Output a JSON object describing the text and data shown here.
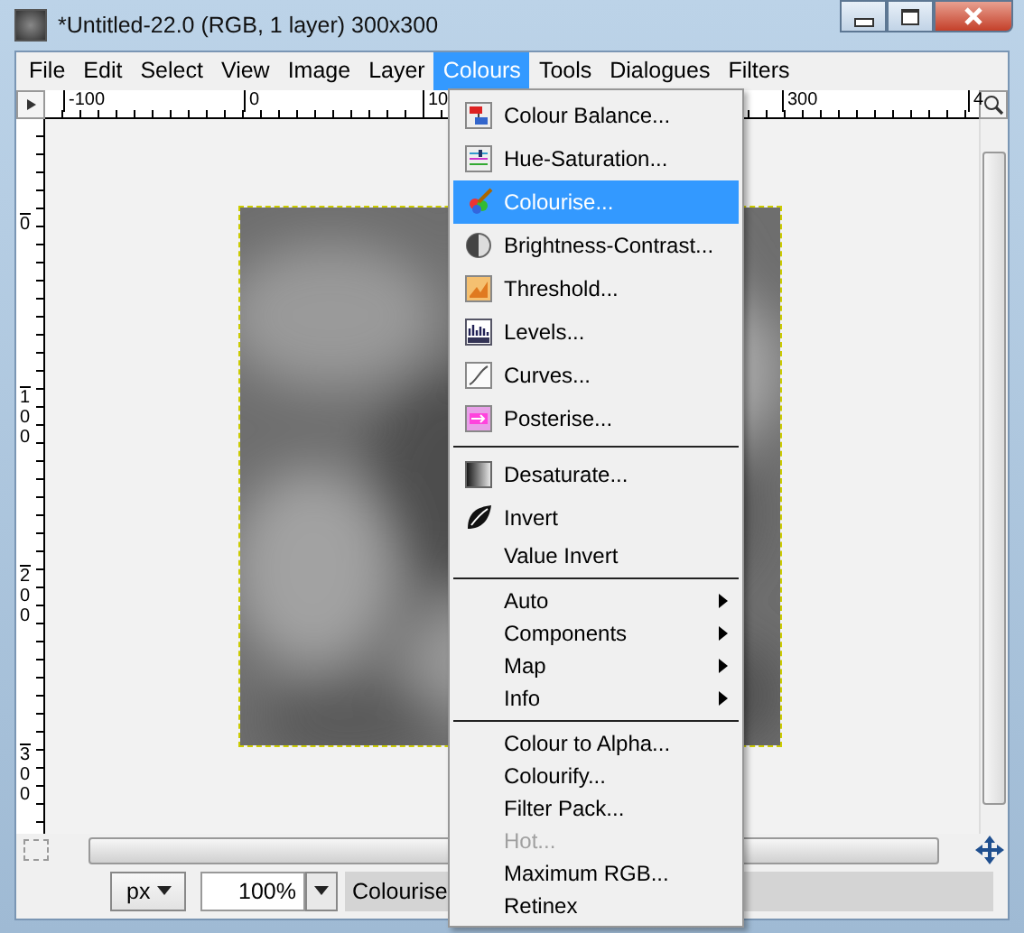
{
  "window": {
    "title": "*Untitled-22.0 (RGB, 1 layer) 300x300"
  },
  "menubar": [
    {
      "label": "File",
      "selected": false
    },
    {
      "label": "Edit",
      "selected": false
    },
    {
      "label": "Select",
      "selected": false
    },
    {
      "label": "View",
      "selected": false
    },
    {
      "label": "Image",
      "selected": false
    },
    {
      "label": "Layer",
      "selected": false
    },
    {
      "label": "Colours",
      "selected": true
    },
    {
      "label": "Tools",
      "selected": false
    },
    {
      "label": "Dialogues",
      "selected": false
    },
    {
      "label": "Filters",
      "selected": false
    }
  ],
  "top_ruler": {
    "labels": [
      "-100",
      "0",
      "10",
      "300",
      "4"
    ]
  },
  "left_ruler": {
    "labels": [
      "0",
      "100",
      "200",
      "300"
    ]
  },
  "status_bar": {
    "unit": "px",
    "zoom": "100%",
    "message": "Colourise"
  },
  "colours_menu": [
    {
      "kind": "icon-item",
      "label": "Colour Balance...",
      "selected": false,
      "disabled": false
    },
    {
      "kind": "icon-item",
      "label": "Hue-Saturation...",
      "selected": false,
      "disabled": false
    },
    {
      "kind": "icon-item",
      "label": "Colourise...",
      "selected": true,
      "disabled": false
    },
    {
      "kind": "icon-item",
      "label": "Brightness-Contrast...",
      "selected": false,
      "disabled": false
    },
    {
      "kind": "icon-item",
      "label": "Threshold...",
      "selected": false,
      "disabled": false
    },
    {
      "kind": "icon-item",
      "label": "Levels...",
      "selected": false,
      "disabled": false
    },
    {
      "kind": "icon-item",
      "label": "Curves...",
      "selected": false,
      "disabled": false
    },
    {
      "kind": "icon-item",
      "label": "Posterise...",
      "selected": false,
      "disabled": false
    },
    {
      "kind": "separator"
    },
    {
      "kind": "icon-item",
      "label": "Desaturate...",
      "selected": false,
      "disabled": false
    },
    {
      "kind": "icon-item",
      "label": "Invert",
      "selected": false,
      "disabled": false
    },
    {
      "kind": "item",
      "label": "Value Invert",
      "selected": false,
      "disabled": false
    },
    {
      "kind": "separator"
    },
    {
      "kind": "submenu",
      "label": "Auto",
      "selected": false,
      "disabled": false
    },
    {
      "kind": "submenu",
      "label": "Components",
      "selected": false,
      "disabled": false
    },
    {
      "kind": "submenu",
      "label": "Map",
      "selected": false,
      "disabled": false
    },
    {
      "kind": "submenu",
      "label": "Info",
      "selected": false,
      "disabled": false
    },
    {
      "kind": "separator"
    },
    {
      "kind": "item",
      "label": "Colour to Alpha...",
      "selected": false,
      "disabled": false
    },
    {
      "kind": "item",
      "label": "Colourify...",
      "selected": false,
      "disabled": false
    },
    {
      "kind": "item",
      "label": "Filter Pack...",
      "selected": false,
      "disabled": false
    },
    {
      "kind": "item",
      "label": "Hot...",
      "selected": false,
      "disabled": true
    },
    {
      "kind": "item",
      "label": "Maximum RGB...",
      "selected": false,
      "disabled": false
    },
    {
      "kind": "item",
      "label": "Retinex",
      "selected": false,
      "disabled": false
    }
  ]
}
